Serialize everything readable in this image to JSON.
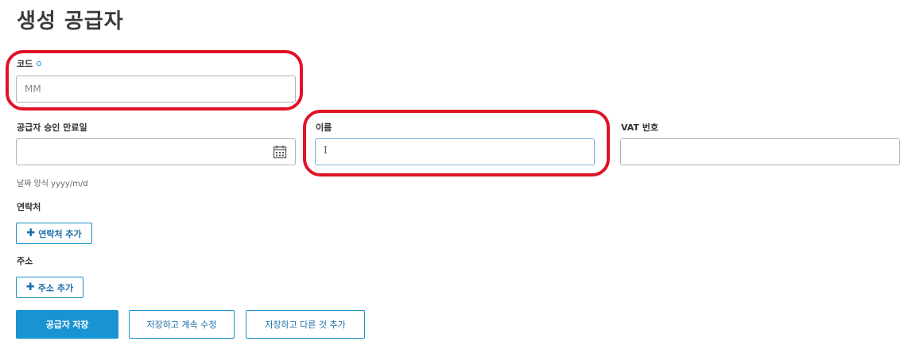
{
  "page": {
    "title": "생성 공급자"
  },
  "form": {
    "code": {
      "label": "코드",
      "value": "",
      "placeholder": "MM"
    },
    "approval_expiry": {
      "label": "공급자 승인 만료일",
      "value": "",
      "hint": "날짜 양식 yyyy/m/d",
      "icon": "calendar-icon"
    },
    "name": {
      "label": "이름",
      "value": ""
    },
    "vat": {
      "label": "VAT 번호",
      "value": ""
    }
  },
  "contacts": {
    "label": "연락처",
    "add_label": "연락처 추가"
  },
  "address": {
    "label": "주소",
    "add_label": "주소 추가"
  },
  "actions": {
    "save": "공급자 저장",
    "save_continue": "저장하고 계속 수정",
    "save_add_another": "저장하고 다른 것 추가"
  },
  "colors": {
    "accent": "#1994d2",
    "highlight": "#e11226"
  }
}
